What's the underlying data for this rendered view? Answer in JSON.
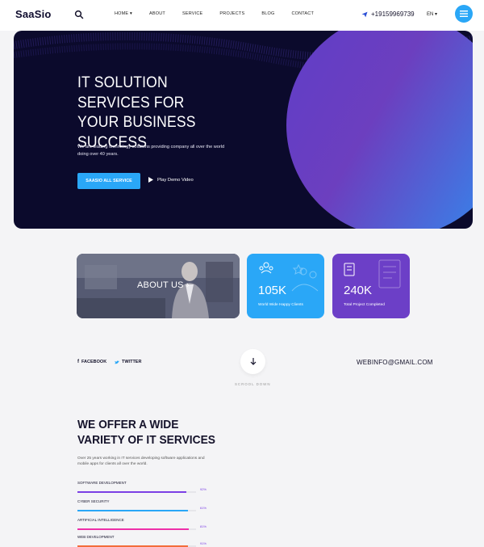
{
  "header": {
    "logo": "SaaSio",
    "nav": [
      "HOME",
      "ABOUT",
      "SERVICE",
      "PROJECTS",
      "BLOG",
      "CONTACT"
    ],
    "phone": "+19159969739",
    "lang": "EN"
  },
  "hero": {
    "title": "IT SOLUTION SERVICES FOR YOUR BUSINESS SUCCESS",
    "description": "We are leading technology solutions providing company all over the world doing over 40 years.",
    "cta": "SAASIO ALL SERVICE",
    "play_label": "Play Demo Video"
  },
  "cards": {
    "about_label": "ABOUT US",
    "stat1": {
      "number": "105K",
      "label": "World Wide Happy Clients"
    },
    "stat2": {
      "number": "240K",
      "label": "Total Project Completed"
    }
  },
  "social": {
    "facebook": "FACEBOOK",
    "twitter": "TWITTER",
    "scroll": "SCROOL DOWN",
    "email": "WEBINFO@GMAIL.COM"
  },
  "services": {
    "title": "WE OFFER A WIDE VARIETY OF IT SERVICES",
    "description": "Over 25 years working in IT services developing software applications and mobile apps for clients all over the world.",
    "skills": [
      {
        "name": "SOFTWARE DEVELOPMENT",
        "percent": "92%",
        "value": 92,
        "color": "#7b3fe4"
      },
      {
        "name": "CYBER SECURITY",
        "percent": "61%",
        "value": 93,
        "color": "#2aa7f7"
      },
      {
        "name": "ARTIFICIAL INTELLIGENCE",
        "percent": "81%",
        "value": 94,
        "color": "#ee2fa9"
      },
      {
        "name": "WEB DEVELOPMENT",
        "percent": "91%",
        "value": 93,
        "color": "#f36d3b"
      }
    ]
  },
  "colors": {
    "primary": "#2aa7f7",
    "purple": "#7b3fe4",
    "dark": "#0b0a2c"
  }
}
